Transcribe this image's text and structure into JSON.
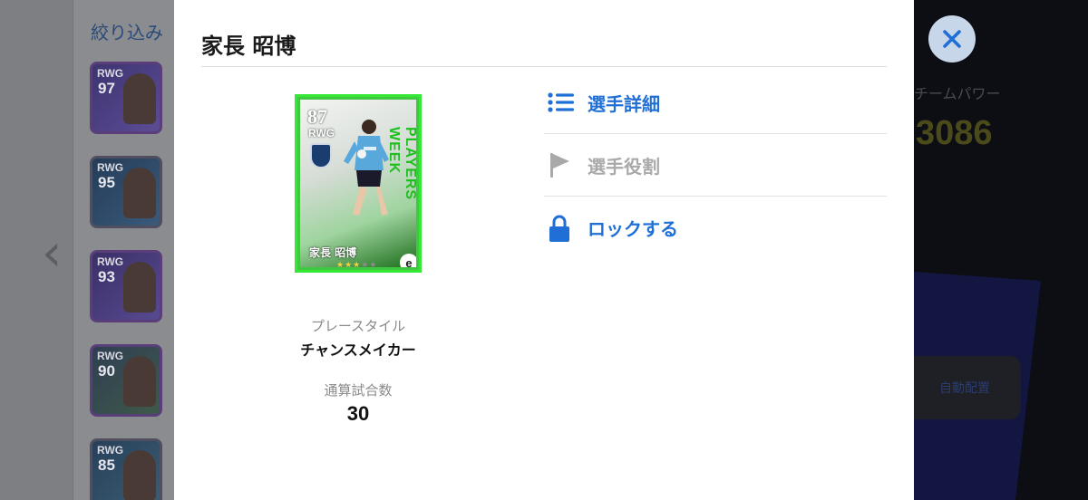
{
  "background": {
    "filter_label": "絞り込み",
    "team_power_label": "チームパワー",
    "team_power_value": "3086",
    "auto_assign_label": "自動配置",
    "list_cards": [
      {
        "position": "RWG",
        "rating": "97"
      },
      {
        "position": "RWG",
        "rating": "95"
      },
      {
        "position": "RWG",
        "rating": "93"
      },
      {
        "position": "RWG",
        "rating": "90"
      },
      {
        "position": "RWG",
        "rating": "85"
      }
    ]
  },
  "modal": {
    "title": "家長 昭博",
    "card": {
      "rating": "87",
      "position": "RWG",
      "name": "家長 昭博",
      "side_text": "PLAYERS WEEK",
      "stars": 3,
      "max_stars": 5,
      "logo_letter": "e"
    },
    "playstyle_label": "プレースタイル",
    "playstyle_value": "チャンスメイカー",
    "matches_label": "通算試合数",
    "matches_value": "30",
    "menu": [
      {
        "label": "選手詳細",
        "icon": "list-icon",
        "enabled": true
      },
      {
        "label": "選手役割",
        "icon": "flag-icon",
        "enabled": false
      },
      {
        "label": "ロックする",
        "icon": "lock-icon",
        "enabled": true
      }
    ]
  },
  "colors": {
    "accent": "#1f6fd6",
    "disabled": "#a9a9a9",
    "card_border": "#36e836"
  }
}
